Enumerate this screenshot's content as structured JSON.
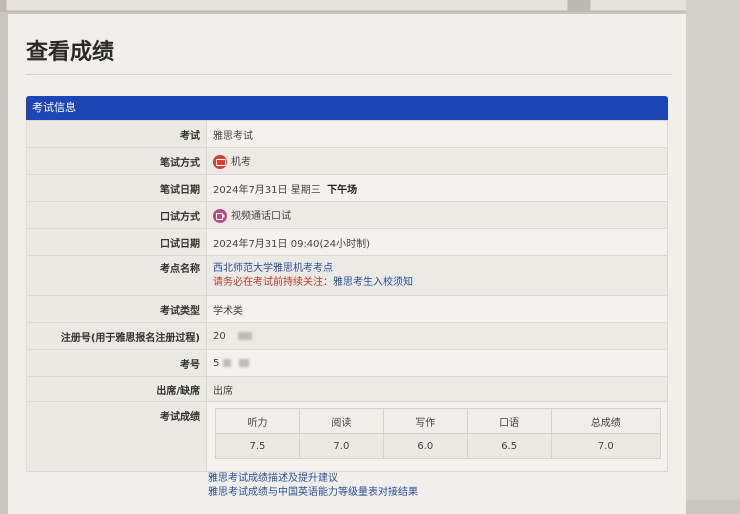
{
  "page": {
    "title": "查看成绩"
  },
  "panel": {
    "title": "考试信息"
  },
  "rows": {
    "exam": {
      "label": "考试",
      "value": "雅思考试"
    },
    "written_mode": {
      "label": "笔试方式",
      "value": "机考",
      "icon": "computer-icon"
    },
    "written_date": {
      "label": "笔试日期",
      "value": "2024年7月31日 星期三",
      "session": "下午场"
    },
    "speaking_mode": {
      "label": "口试方式",
      "value": "视频通话口试",
      "icon": "video-call-icon"
    },
    "speaking_date": {
      "label": "口试日期",
      "value": "2024年7月31日 09:40(24小时制)"
    },
    "venue": {
      "label": "考点名称",
      "name": "西北师范大学雅思机考考点",
      "notice_prefix": "请务必在考试前持续关注：",
      "notice_link": "雅思考生入校须知"
    },
    "exam_type": {
      "label": "考试类型",
      "value": "学术类"
    },
    "registration": {
      "label": "注册号(用于雅思报名注册过程)",
      "value": "20"
    },
    "candidate_no": {
      "label": "考号",
      "value": "5"
    },
    "attendance": {
      "label": "出席/缺席",
      "value": "出席"
    },
    "scores": {
      "label": "考试成绩",
      "headers": [
        "听力",
        "阅读",
        "写作",
        "口语",
        "总成绩"
      ],
      "values": [
        "7.5",
        "7.0",
        "6.0",
        "6.5",
        "7.0"
      ]
    }
  },
  "links": {
    "score_desc": "雅思考试成绩描述及提升建议",
    "cse_mapping": "雅思考试成绩与中国英语能力等级量表对接结果"
  },
  "colors": {
    "panel_header": "#1d45b8",
    "link": "#2b4f9e",
    "warning": "#c0392b"
  }
}
